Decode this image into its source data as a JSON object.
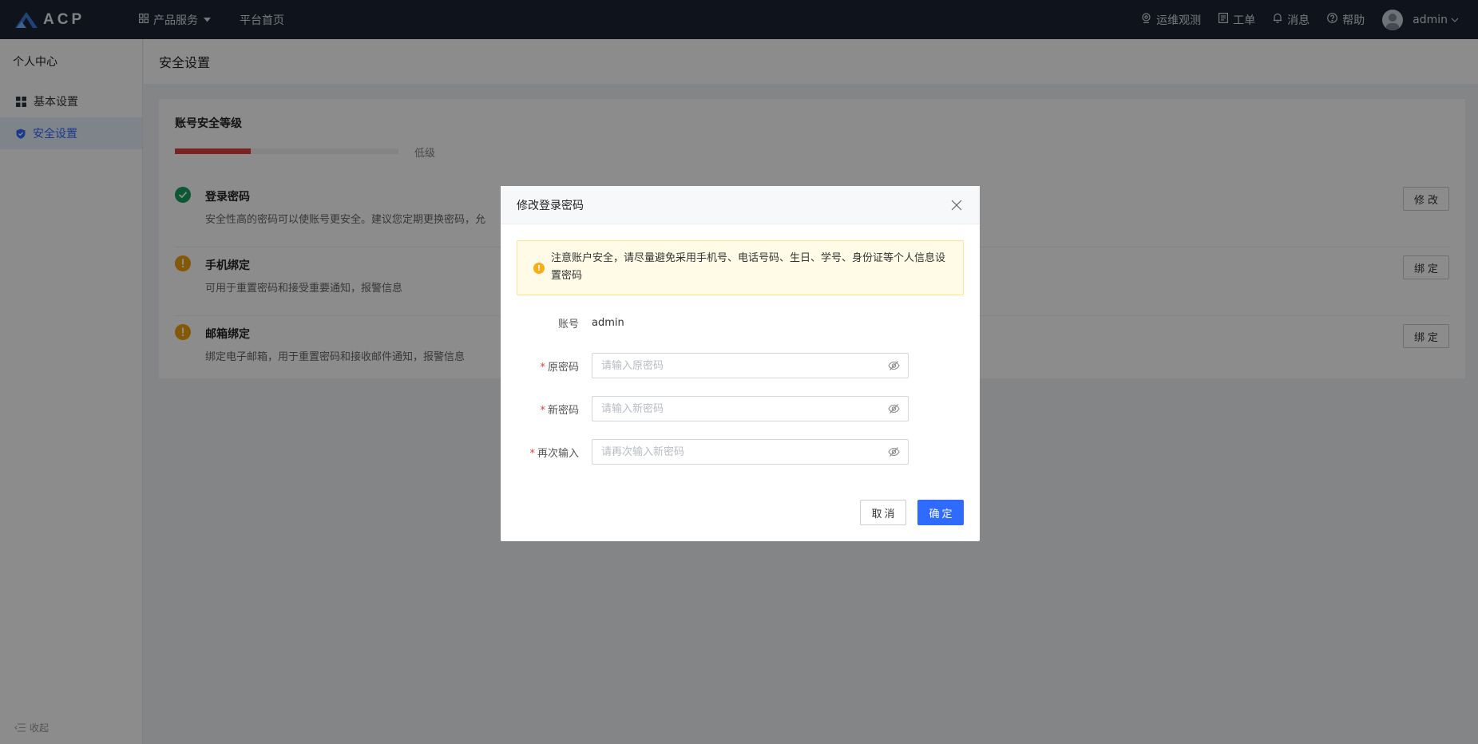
{
  "topbar": {
    "logo_text": "ACP",
    "nav": [
      {
        "label": "产品服务",
        "icon": "grid-icon"
      },
      {
        "label": "平台首页"
      }
    ],
    "right": [
      {
        "label": "运维观测",
        "icon": "monitor-icon"
      },
      {
        "label": "工单",
        "icon": "ticket-icon"
      },
      {
        "label": "消息",
        "icon": "bell-icon"
      },
      {
        "label": "帮助",
        "icon": "help-icon"
      }
    ],
    "user": "admin"
  },
  "sidebar": {
    "title": "个人中心",
    "items": [
      {
        "label": "基本设置",
        "icon": "dashboard-icon",
        "active": false
      },
      {
        "label": "安全设置",
        "icon": "shield-icon",
        "active": true
      }
    ],
    "collapse_label": "收起"
  },
  "main": {
    "title": "安全设置",
    "security": {
      "title": "账号安全等级",
      "level_label": "低级",
      "level_fraction": 0.34,
      "level_color": "#e53c3c",
      "items": [
        {
          "name": "登录密码",
          "desc": "安全性高的密码可以使账号更安全。建议您定期更换密码，允",
          "status": "ok",
          "button": "修改"
        },
        {
          "name": "手机绑定",
          "desc": "可用于重置密码和接受重要通知，报警信息",
          "status": "warn",
          "button": "绑定"
        },
        {
          "name": "邮箱绑定",
          "desc": "绑定电子邮箱，用于重置密码和接收邮件通知，报警信息",
          "status": "warn",
          "button": "绑定"
        }
      ]
    }
  },
  "modal": {
    "title": "修改登录密码",
    "alert": "注意账户安全，请尽量避免采用手机号、电话号码、生日、学号、身份证等个人信息设置密码",
    "account_label": "账号",
    "account_value": "admin",
    "fields": [
      {
        "label": "原密码",
        "placeholder": "请输入原密码"
      },
      {
        "label": "新密码",
        "placeholder": "请输入新密码"
      },
      {
        "label": "再次输入",
        "placeholder": "请再次输入新密码"
      }
    ],
    "cancel": "取消",
    "ok": "确定"
  },
  "colors": {
    "topbar_bg": "#1c2434",
    "primary": "#2f6bff",
    "success": "#19a15f",
    "warning": "#f0a20a",
    "danger": "#e53c3c"
  }
}
